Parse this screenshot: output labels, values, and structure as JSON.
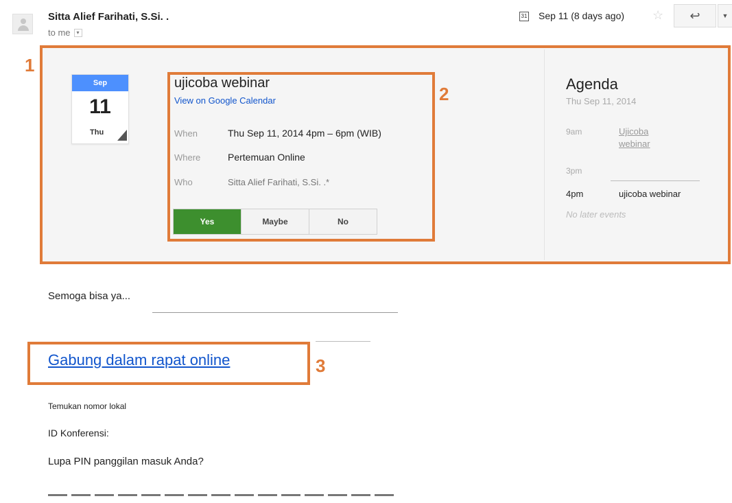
{
  "header": {
    "sender": "Sitta Alief Farihati, S.Si. .",
    "recipient": "to me",
    "calendar_icon": "calendar-icon",
    "date": "Sep 11 (8 days ago)",
    "star_icon": "star-icon",
    "reply_icon": "reply-icon",
    "more_icon": "chevron-down-icon"
  },
  "invite": {
    "mini_calendar": {
      "month": "Sep",
      "day": "11",
      "weekday": "Thu"
    },
    "event_title": "ujicoba webinar",
    "view_link": "View on Google Calendar",
    "when_label": "When",
    "when_value": "Thu Sep 11, 2014 4pm – 6pm (WIB)",
    "where_label": "Where",
    "where_value": "Pertemuan Online",
    "who_label": "Who",
    "who_value": "Sitta Alief Farihati, S.Si. .*",
    "rsvp": {
      "yes": "Yes",
      "maybe": "Maybe",
      "no": "No"
    }
  },
  "agenda": {
    "title": "Agenda",
    "date": "Thu Sep 11, 2014",
    "items": [
      {
        "time": "9am",
        "event": "Ujicoba webinar"
      },
      {
        "time": "3pm",
        "event": ""
      }
    ],
    "current": {
      "time": "4pm",
      "event": "ujicoba webinar"
    },
    "no_later": "No later events"
  },
  "annotations": {
    "one": "1",
    "two": "2",
    "three": "3"
  },
  "body": {
    "greeting": "Semoga bisa ya...",
    "join_link": "Gabung dalam rapat online",
    "find_number": "Temukan nomor lokal",
    "conference_id": "ID Konferensi:",
    "forgot_pin": "Lupa PIN panggilan masuk Anda?"
  },
  "colors": {
    "annotation": "#e07b39",
    "rsvp_yes": "#3d8f2e",
    "calendar_header": "#4d90fe",
    "link": "#1155cc"
  }
}
